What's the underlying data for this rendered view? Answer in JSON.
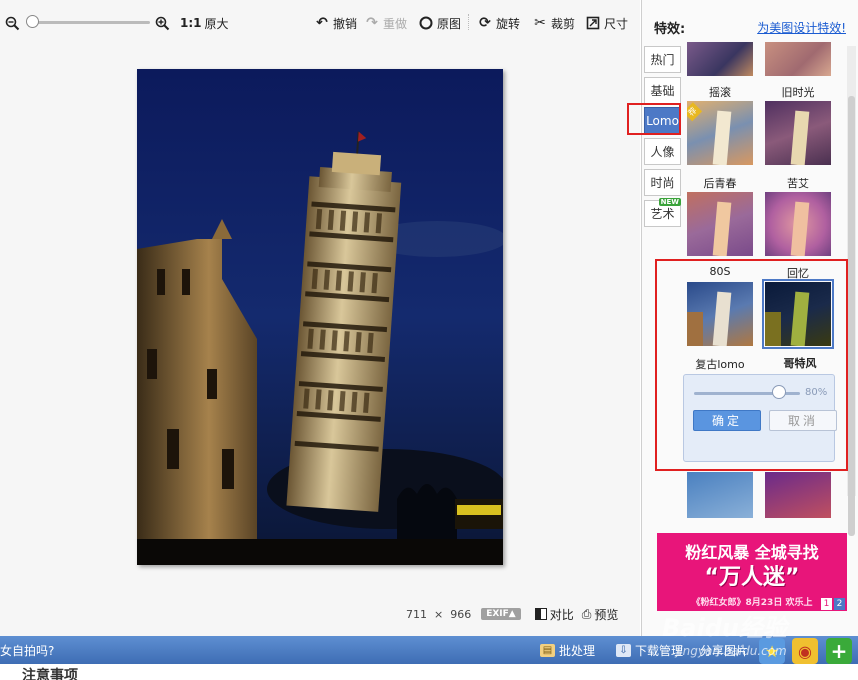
{
  "toolbar": {
    "ratio_label": "1:1",
    "original_size": "原大",
    "undo": "撤销",
    "redo": "重做",
    "original_image": "原图",
    "rotate": "旋转",
    "crop": "裁剪",
    "size": "尺寸"
  },
  "image_info": {
    "width": "711",
    "times": "×",
    "height": "966",
    "exif": "EXIF▲",
    "compare": "对比",
    "preview": "预览"
  },
  "panel": {
    "title": "特效:",
    "design_link": "为美图设计特效!",
    "tabs": [
      {
        "label": "热门"
      },
      {
        "label": "基础"
      },
      {
        "label": "Lomo"
      },
      {
        "label": "人像"
      },
      {
        "label": "时尚"
      },
      {
        "label": "艺术"
      }
    ],
    "new_badge": "NEW",
    "effects": [
      {
        "label": "摇滚"
      },
      {
        "label": "旧时光"
      },
      {
        "label": "后青春"
      },
      {
        "label": "苦艾"
      },
      {
        "label": "80S"
      },
      {
        "label": "回忆"
      },
      {
        "label": "复古lomo"
      },
      {
        "label": "哥特风"
      }
    ],
    "recommend_badge": "荐",
    "intensity_value": "80%",
    "intensity_fraction": 0.8,
    "ok_label": "确定",
    "cancel_label": "取消"
  },
  "ad": {
    "line1": "粉红风暴 全城寻找",
    "line2": "“万人迷”",
    "line3": "《粉红女郎》8月23日 欢乐上",
    "pages": [
      "1",
      "2"
    ]
  },
  "statusbar": {
    "left_text": "女自拍吗?",
    "batch": "批处理",
    "download": "下载管理",
    "share": "分享图片"
  },
  "footer": {
    "text": "注意事项"
  },
  "watermark": {
    "text": "Baidu经验",
    "sub": "jingyan.baidu.com"
  },
  "colors": {
    "accent": "#4d79c6",
    "highlight_box": "#e02020",
    "statusbar": "#4a7bc2",
    "ad_pink": "#e8157a",
    "link": "#1a5bd1"
  }
}
